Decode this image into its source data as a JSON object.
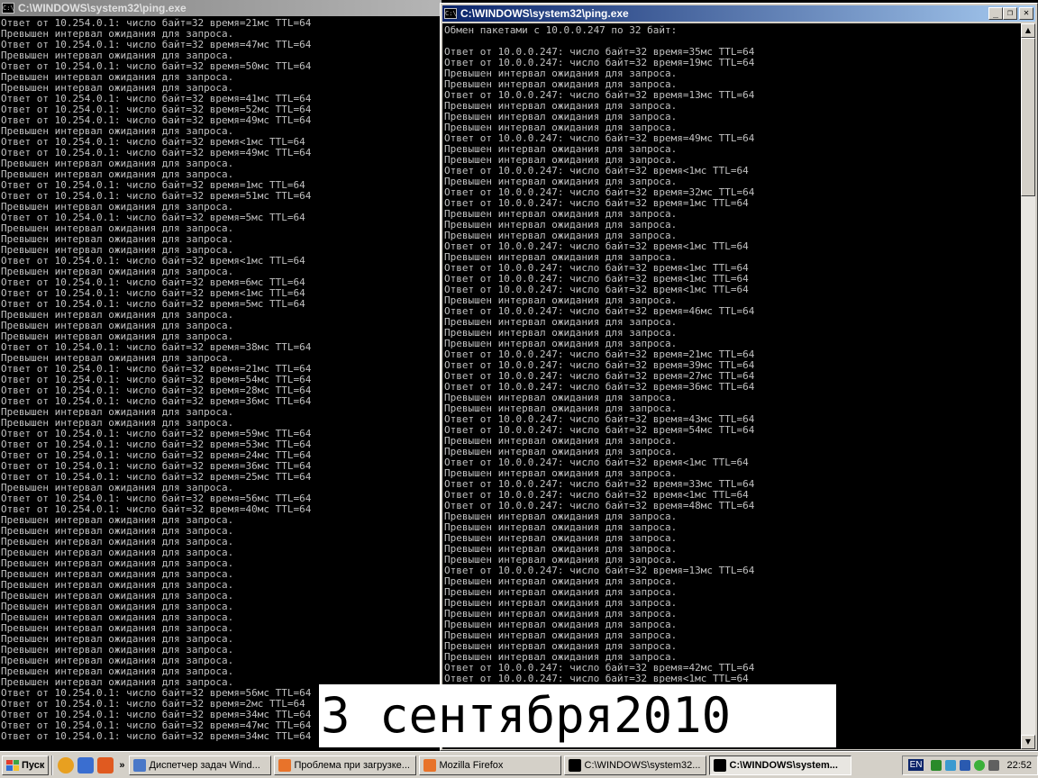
{
  "left_window": {
    "title": "C:\\WINDOWS\\system32\\ping.exe",
    "lines": [
      "Ответ от 10.254.0.1: число байт=32 время=21мс TTL=64",
      "Превышен интервал ожидания для запроса.",
      "Ответ от 10.254.0.1: число байт=32 время=47мс TTL=64",
      "Превышен интервал ожидания для запроса.",
      "Ответ от 10.254.0.1: число байт=32 время=50мс TTL=64",
      "Превышен интервал ожидания для запроса.",
      "Превышен интервал ожидания для запроса.",
      "Ответ от 10.254.0.1: число байт=32 время=41мс TTL=64",
      "Ответ от 10.254.0.1: число байт=32 время=52мс TTL=64",
      "Ответ от 10.254.0.1: число байт=32 время=49мс TTL=64",
      "Превышен интервал ожидания для запроса.",
      "Ответ от 10.254.0.1: число байт=32 время<1мс TTL=64",
      "Ответ от 10.254.0.1: число байт=32 время=49мс TTL=64",
      "Превышен интервал ожидания для запроса.",
      "Превышен интервал ожидания для запроса.",
      "Ответ от 10.254.0.1: число байт=32 время=1мс TTL=64",
      "Ответ от 10.254.0.1: число байт=32 время=51мс TTL=64",
      "Превышен интервал ожидания для запроса.",
      "Ответ от 10.254.0.1: число байт=32 время=5мс TTL=64",
      "Превышен интервал ожидания для запроса.",
      "Превышен интервал ожидания для запроса.",
      "Превышен интервал ожидания для запроса.",
      "Ответ от 10.254.0.1: число байт=32 время<1мс TTL=64",
      "Превышен интервал ожидания для запроса.",
      "Ответ от 10.254.0.1: число байт=32 время=6мс TTL=64",
      "Ответ от 10.254.0.1: число байт=32 время<1мс TTL=64",
      "Ответ от 10.254.0.1: число байт=32 время=5мс TTL=64",
      "Превышен интервал ожидания для запроса.",
      "Превышен интервал ожидания для запроса.",
      "Превышен интервал ожидания для запроса.",
      "Ответ от 10.254.0.1: число байт=32 время=38мс TTL=64",
      "Превышен интервал ожидания для запроса.",
      "Ответ от 10.254.0.1: число байт=32 время=21мс TTL=64",
      "Ответ от 10.254.0.1: число байт=32 время=54мс TTL=64",
      "Ответ от 10.254.0.1: число байт=32 время=28мс TTL=64",
      "Ответ от 10.254.0.1: число байт=32 время=36мс TTL=64",
      "Превышен интервал ожидания для запроса.",
      "Превышен интервал ожидания для запроса.",
      "Ответ от 10.254.0.1: число байт=32 время=59мс TTL=64",
      "Ответ от 10.254.0.1: число байт=32 время=53мс TTL=64",
      "Ответ от 10.254.0.1: число байт=32 время=24мс TTL=64",
      "Ответ от 10.254.0.1: число байт=32 время=36мс TTL=64",
      "Ответ от 10.254.0.1: число байт=32 время=25мс TTL=64",
      "Превышен интервал ожидания для запроса.",
      "Ответ от 10.254.0.1: число байт=32 время=56мс TTL=64",
      "Ответ от 10.254.0.1: число байт=32 время=40мс TTL=64",
      "Превышен интервал ожидания для запроса.",
      "Превышен интервал ожидания для запроса.",
      "Превышен интервал ожидания для запроса.",
      "Превышен интервал ожидания для запроса.",
      "Превышен интервал ожидания для запроса.",
      "Превышен интервал ожидания для запроса.",
      "Превышен интервал ожидания для запроса.",
      "Превышен интервал ожидания для запроса.",
      "Превышен интервал ожидания для запроса.",
      "Превышен интервал ожидания для запроса.",
      "Превышен интервал ожидания для запроса.",
      "Превышен интервал ожидания для запроса.",
      "Превышен интервал ожидания для запроса.",
      "Превышен интервал ожидания для запроса.",
      "Превышен интервал ожидания для запроса.",
      "Превышен интервал ожидания для запроса.",
      "Ответ от 10.254.0.1: число байт=32 время=56мс TTL=64",
      "Ответ от 10.254.0.1: число байт=32 время=2мс TTL=64",
      "Ответ от 10.254.0.1: число байт=32 время=34мс TTL=64",
      "Ответ от 10.254.0.1: число байт=32 время=47мс TTL=64",
      "Ответ от 10.254.0.1: число байт=32 время=34мс TTL=64"
    ]
  },
  "right_window": {
    "title": "C:\\WINDOWS\\system32\\ping.exe",
    "buttons": {
      "minimize": "_",
      "maximize": "❐",
      "close": "✕"
    },
    "lines": [
      "Обмен пакетами с 10.0.0.247 по 32 байт:",
      "",
      "Ответ от 10.0.0.247: число байт=32 время=35мс TTL=64",
      "Ответ от 10.0.0.247: число байт=32 время=19мс TTL=64",
      "Превышен интервал ожидания для запроса.",
      "Превышен интервал ожидания для запроса.",
      "Ответ от 10.0.0.247: число байт=32 время=13мс TTL=64",
      "Превышен интервал ожидания для запроса.",
      "Превышен интервал ожидания для запроса.",
      "Превышен интервал ожидания для запроса.",
      "Ответ от 10.0.0.247: число байт=32 время=49мс TTL=64",
      "Превышен интервал ожидания для запроса.",
      "Превышен интервал ожидания для запроса.",
      "Ответ от 10.0.0.247: число байт=32 время<1мс TTL=64",
      "Превышен интервал ожидания для запроса.",
      "Ответ от 10.0.0.247: число байт=32 время=32мс TTL=64",
      "Ответ от 10.0.0.247: число байт=32 время=1мс TTL=64",
      "Превышен интервал ожидания для запроса.",
      "Превышен интервал ожидания для запроса.",
      "Превышен интервал ожидания для запроса.",
      "Ответ от 10.0.0.247: число байт=32 время<1мс TTL=64",
      "Превышен интервал ожидания для запроса.",
      "Ответ от 10.0.0.247: число байт=32 время<1мс TTL=64",
      "Ответ от 10.0.0.247: число байт=32 время<1мс TTL=64",
      "Ответ от 10.0.0.247: число байт=32 время<1мс TTL=64",
      "Превышен интервал ожидания для запроса.",
      "Ответ от 10.0.0.247: число байт=32 время=46мс TTL=64",
      "Превышен интервал ожидания для запроса.",
      "Превышен интервал ожидания для запроса.",
      "Превышен интервал ожидания для запроса.",
      "Ответ от 10.0.0.247: число байт=32 время=21мс TTL=64",
      "Ответ от 10.0.0.247: число байт=32 время=39мс TTL=64",
      "Ответ от 10.0.0.247: число байт=32 время=27мс TTL=64",
      "Ответ от 10.0.0.247: число байт=32 время=36мс TTL=64",
      "Превышен интервал ожидания для запроса.",
      "Превышен интервал ожидания для запроса.",
      "Ответ от 10.0.0.247: число байт=32 время=43мс TTL=64",
      "Ответ от 10.0.0.247: число байт=32 время=54мс TTL=64",
      "Превышен интервал ожидания для запроса.",
      "Превышен интервал ожидания для запроса.",
      "Ответ от 10.0.0.247: число байт=32 время<1мс TTL=64",
      "Превышен интервал ожидания для запроса.",
      "Ответ от 10.0.0.247: число байт=32 время=33мс TTL=64",
      "Ответ от 10.0.0.247: число байт=32 время<1мс TTL=64",
      "Ответ от 10.0.0.247: число байт=32 время=48мс TTL=64",
      "Превышен интервал ожидания для запроса.",
      "Превышен интервал ожидания для запроса.",
      "Превышен интервал ожидания для запроса.",
      "Превышен интервал ожидания для запроса.",
      "Превышен интервал ожидания для запроса.",
      "Ответ от 10.0.0.247: число байт=32 время=13мс TTL=64",
      "Превышен интервал ожидания для запроса.",
      "Превышен интервал ожидания для запроса.",
      "Превышен интервал ожидания для запроса.",
      "Превышен интервал ожидания для запроса.",
      "Превышен интервал ожидания для запроса.",
      "Превышен интервал ожидания для запроса.",
      "Превышен интервал ожидания для запроса.",
      "Превышен интервал ожидания для запроса.",
      "Ответ от 10.0.0.247: число байт=32 время=42мс TTL=64",
      "Ответ от 10.0.0.247: число байт=32 время<1мс TTL=64"
    ]
  },
  "caption": "3 сентября2010",
  "taskbar": {
    "start_label": "Пуск",
    "chevron": "»",
    "tasks": [
      {
        "label": "Диспетчер задач Wind...",
        "icon_color": "#4a78c8",
        "active": false
      },
      {
        "label": "Проблема при загрузке...",
        "icon_color": "#e8732a",
        "active": false
      },
      {
        "label": "Mozilla Firefox",
        "icon_color": "#e8732a",
        "active": false
      },
      {
        "label": "C:\\WINDOWS\\system32...",
        "icon_color": "#000000",
        "active": false
      },
      {
        "label": "C:\\WINDOWS\\system...",
        "icon_color": "#000000",
        "active": true
      }
    ],
    "language": "EN",
    "clock": "22:52"
  },
  "colors": {
    "console_text": "#c0c0c0",
    "console_bg": "#000000",
    "active_title_start": "#0a246a",
    "active_title_end": "#a6caf0",
    "inactive_title_start": "#808080",
    "inactive_title_end": "#b5b5b5",
    "chrome": "#d4d0c8"
  }
}
